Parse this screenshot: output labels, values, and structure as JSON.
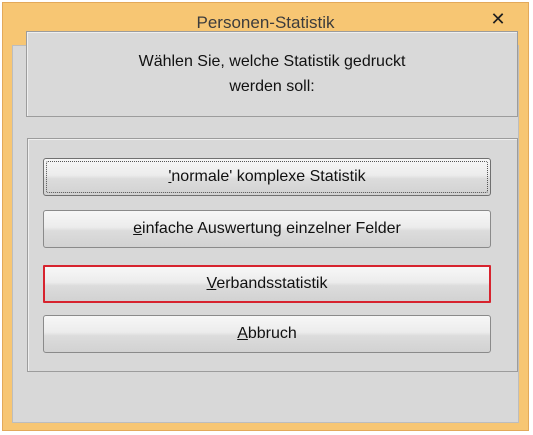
{
  "window": {
    "title": "Personen-Statistik",
    "close_glyph": "✕",
    "accent_color": "#f7c673"
  },
  "prompt": {
    "line1": "Wählen Sie, welche Statistik gedruckt",
    "line2": "werden soll:"
  },
  "buttons": [
    {
      "mnemonic": "'",
      "rest": "normale' komplexe Statistik",
      "focused": true
    },
    {
      "mnemonic": "e",
      "rest": "infache Auswertung einzelner Felder",
      "focused": false
    },
    {
      "mnemonic": "V",
      "rest": "erbandsstatistik",
      "highlighted": true,
      "highlight_color": "#d7232e"
    },
    {
      "mnemonic": "A",
      "rest": "bbruch",
      "focused": false
    }
  ]
}
